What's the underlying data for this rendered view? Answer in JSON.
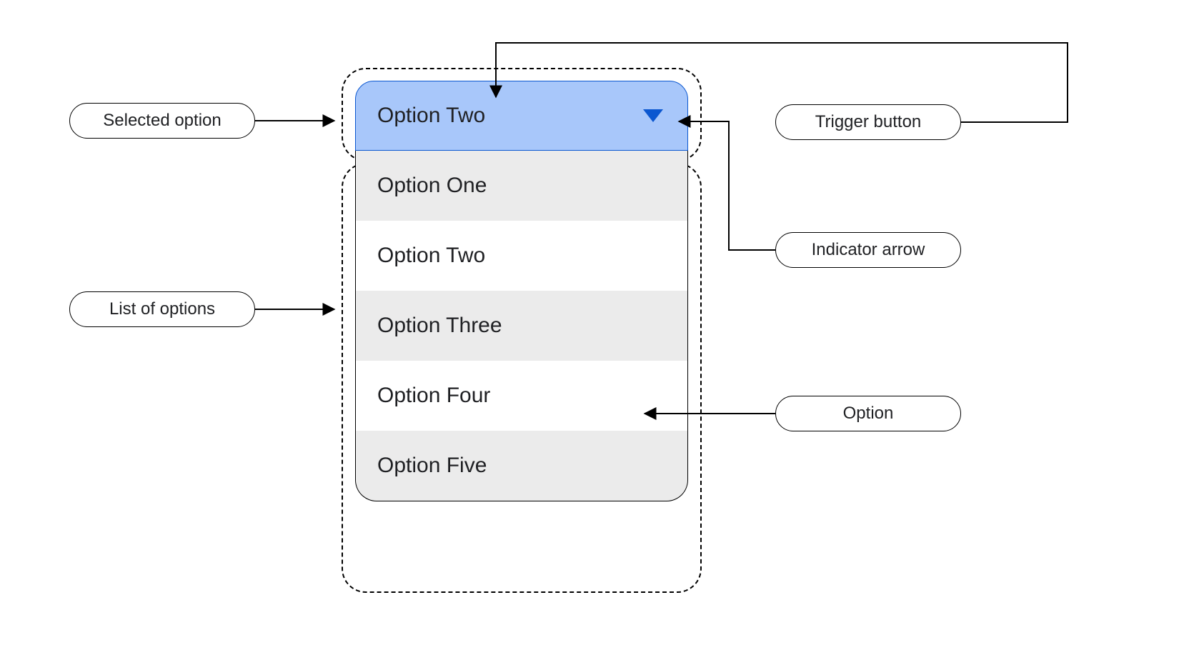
{
  "dropdown": {
    "selected_label": "Option Two",
    "options": [
      "Option One",
      "Option Two",
      "Option Three",
      "Option  Four",
      "Option Five"
    ]
  },
  "annotations": {
    "selected_option": "Selected option",
    "list_of_options": "List of options",
    "trigger_button": "Trigger button",
    "indicator_arrow": "Indicator arrow",
    "option": "Option"
  },
  "colors": {
    "trigger_fill": "#a8c7fa",
    "trigger_border": "#0b57d0",
    "option_alt_bg": "#ebebeb",
    "arrow_fill": "#0b57d0"
  }
}
